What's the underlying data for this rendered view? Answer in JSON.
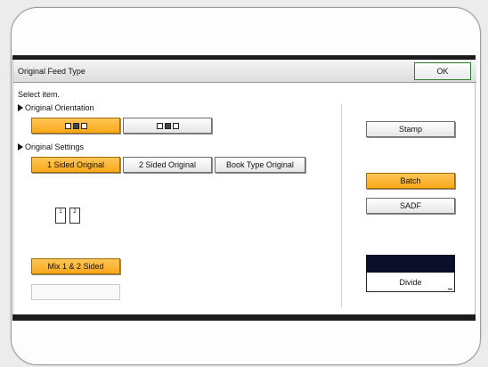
{
  "dialog": {
    "title": "Original Feed Type",
    "ok_label": "OK",
    "instruction": "Select item."
  },
  "orientation": {
    "label": "Original Orientation",
    "options": [
      {
        "icon": "orientation-readable-icon",
        "selected": true
      },
      {
        "icon": "orientation-unreadable-icon",
        "selected": false
      }
    ]
  },
  "settings": {
    "label": "Original Settings",
    "options": [
      {
        "label": "1 Sided Original",
        "selected": true
      },
      {
        "label": "2 Sided Original",
        "selected": false
      },
      {
        "label": "Book Type Original",
        "selected": false
      }
    ],
    "page_numbers": [
      "1",
      "2"
    ],
    "mix_label": "Mix 1 & 2 Sided",
    "mix_selected": true
  },
  "right_panel": {
    "stamp_label": "Stamp",
    "batch_label": "Batch",
    "batch_selected": true,
    "sadf_label": "SADF",
    "divide_label": "Divide"
  },
  "colors": {
    "selected": "#f9a818",
    "ok_border": "#2d7d2d",
    "bezel": "#1c1c1c"
  }
}
